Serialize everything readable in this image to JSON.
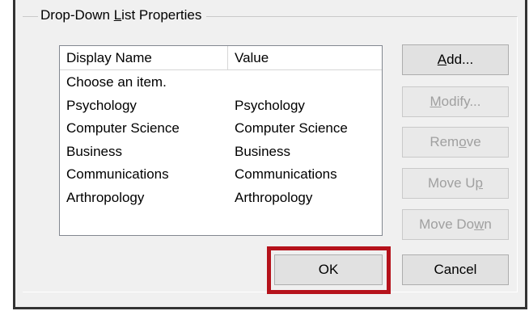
{
  "groupbox": {
    "title_before": "Drop-Down ",
    "title_accel": "L",
    "title_after": "ist Properties"
  },
  "listview": {
    "columns": [
      "Display Name",
      "Value"
    ],
    "rows": [
      {
        "display": "Choose an item.",
        "value": ""
      },
      {
        "display": "Psychology",
        "value": "Psychology"
      },
      {
        "display": "Computer Science",
        "value": "Computer Science"
      },
      {
        "display": "Business",
        "value": "Business"
      },
      {
        "display": "Communications",
        "value": "Communications"
      },
      {
        "display": "Arthropology",
        "value": "Arthropology"
      }
    ]
  },
  "buttons": {
    "add": {
      "before": "",
      "accel": "A",
      "after": "dd...",
      "enabled": true
    },
    "modify": {
      "before": "",
      "accel": "M",
      "after": "odify...",
      "enabled": false
    },
    "remove": {
      "before": "Rem",
      "accel": "o",
      "after": "ve",
      "enabled": false
    },
    "move_up": {
      "before": "Move U",
      "accel": "p",
      "after": "",
      "enabled": false
    },
    "move_down": {
      "before": "Move Do",
      "accel": "w",
      "after": "n",
      "enabled": false
    },
    "ok": "OK",
    "cancel": "Cancel"
  },
  "colors": {
    "highlight": "#b5121b",
    "dialog_bg": "#f0f0f0",
    "disabled_text": "#a0a0a0"
  }
}
